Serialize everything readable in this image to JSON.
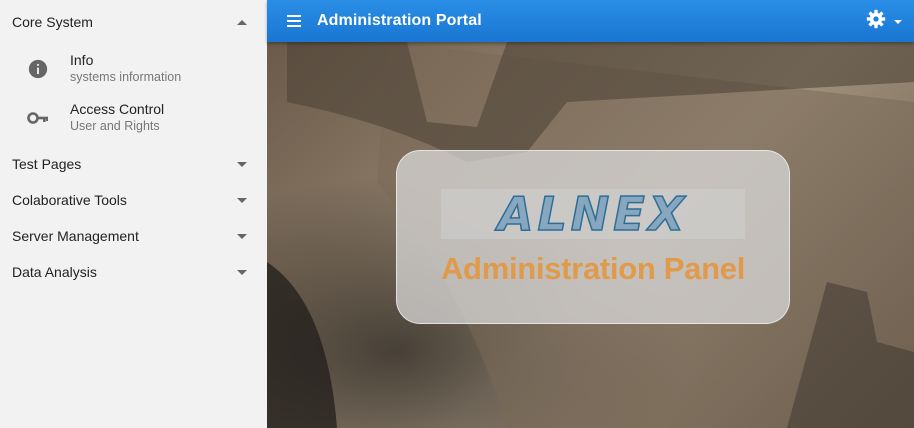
{
  "header": {
    "title": "Administration Portal"
  },
  "sidebar": {
    "sections": [
      {
        "label": "Core System",
        "expanded": true,
        "items": [
          {
            "label": "Info",
            "subtitle": "systems information",
            "icon": "info-icon"
          },
          {
            "label": "Access Control",
            "subtitle": "User and Rights",
            "icon": "key-icon"
          }
        ]
      },
      {
        "label": "Test Pages",
        "expanded": false
      },
      {
        "label": "Colaborative Tools",
        "expanded": false
      },
      {
        "label": "Server Management",
        "expanded": false
      },
      {
        "label": "Data Analysis",
        "expanded": false
      }
    ]
  },
  "main": {
    "logo_text": "ALNEX",
    "panel_title": "Administration Panel"
  },
  "colors": {
    "accent": "#1976d2",
    "panel_title": "#e09a4a",
    "logo": "#2d6e98"
  }
}
